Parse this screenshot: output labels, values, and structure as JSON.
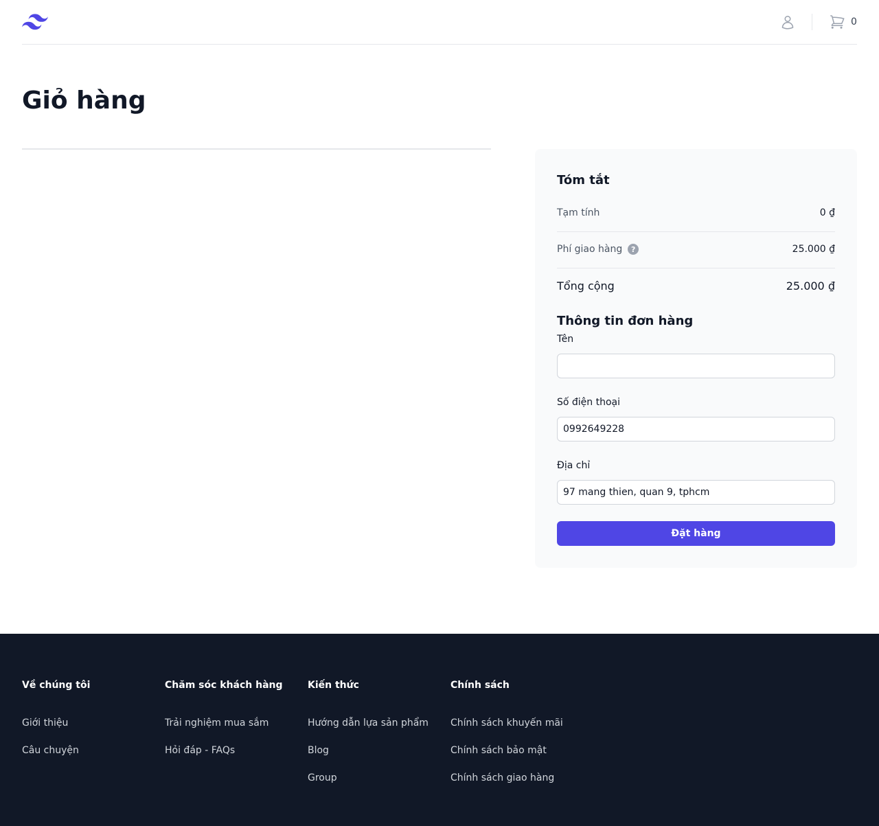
{
  "header": {
    "logo": "tailwind-wave-logo",
    "user_icon": "user-icon",
    "cart_icon": "cart-icon",
    "cart_count": "0"
  },
  "page": {
    "title": "Giỏ hàng"
  },
  "summary": {
    "title": "Tóm tắt",
    "subtotal_label": "Tạm tính",
    "subtotal_value": "0 ₫",
    "shipping_label": "Phí giao hàng",
    "shipping_value": "25.000 ₫",
    "total_label": "Tổng cộng",
    "total_value": "25.000 ₫"
  },
  "order_info": {
    "title": "Thông tin đơn hàng",
    "name_label": "Tên",
    "name_value": "",
    "phone_label": "Số điện thoại",
    "phone_value": "0992649228",
    "address_label": "Địa chỉ",
    "address_value": "97 mang thien, quan 9, tphcm",
    "submit_label": "Đặt hàng"
  },
  "colors": {
    "accent": "#4f46e5",
    "footer_bg": "#111827",
    "panel_bg": "#f9fafb"
  },
  "footer": {
    "columns": [
      {
        "title": "Về chúng tôi",
        "links": [
          "Giới thiệu",
          "Câu chuyện"
        ]
      },
      {
        "title": "Chăm sóc khách hàng",
        "links": [
          "Trải nghiệm mua sắm",
          "Hỏi đáp - FAQs"
        ]
      },
      {
        "title": "Kiến thức",
        "links": [
          "Hướng dẫn lựa sản phẩm",
          "Blog",
          "Group"
        ]
      },
      {
        "title": "Chính sách",
        "links": [
          "Chính sách khuyến mãi",
          "Chính sách bảo mật",
          "Chính sách giao hàng"
        ]
      }
    ]
  }
}
